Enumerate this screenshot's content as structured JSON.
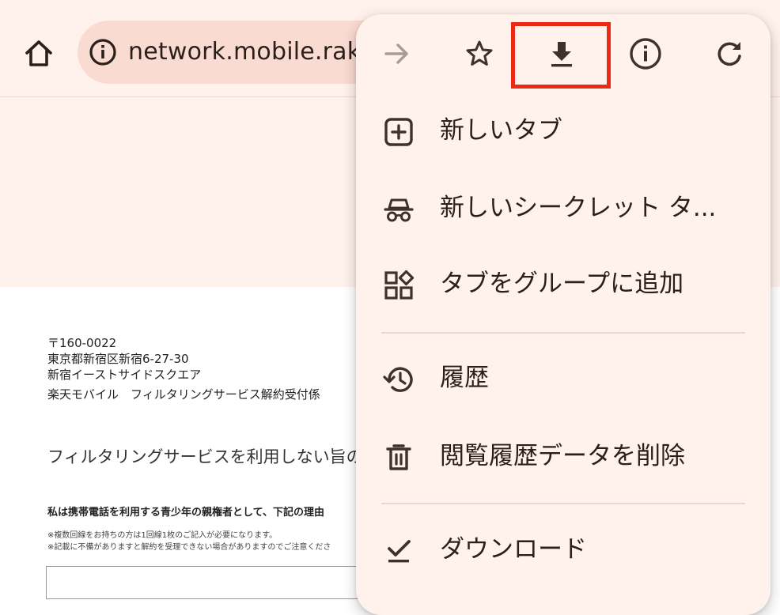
{
  "browser": {
    "url": "network.mobile.raku"
  },
  "page": {
    "address_lines": [
      "〒160-0022",
      "東京都新宿区新宿6-27-30",
      "新宿イーストサイドスクエア",
      "楽天モバイル　フィルタリングサービス解約受付係"
    ],
    "lead_text": "フィルタリングサービスを利用しない旨の",
    "bold_text": "私は携帯電話を利用する青少年の親権者として、下記の理由",
    "notes": [
      "※複数回線をお持ちの方は1回線1枚のご記入が必要になります。",
      "※記載に不備がありますと解約を受理できない場合がありますのでご注意くださ"
    ]
  },
  "menu": {
    "toolbar_icons": [
      "forward-arrow-icon",
      "star-icon",
      "download-icon",
      "info-icon",
      "reload-icon"
    ],
    "highlight_color": "#ea2a15",
    "items": [
      {
        "icon": "new-tab-icon",
        "label": "新しいタブ"
      },
      {
        "icon": "incognito-icon",
        "label": "新しいシークレット タ..."
      },
      {
        "icon": "tab-group-icon",
        "label": "タブをグループに追加"
      },
      {
        "icon": "history-icon",
        "label": "履歴"
      },
      {
        "icon": "trash-icon",
        "label": "閲覧履歴データを削除"
      },
      {
        "icon": "downloads-icon",
        "label": "ダウンロード"
      }
    ]
  },
  "colors": {
    "toolbar_bg": "#fff1ec",
    "urlbar_bg": "#fadbd2",
    "menu_bg": "#fff1ec",
    "icon_color": "#3e302c",
    "disabled_icon": "#a89a95"
  }
}
